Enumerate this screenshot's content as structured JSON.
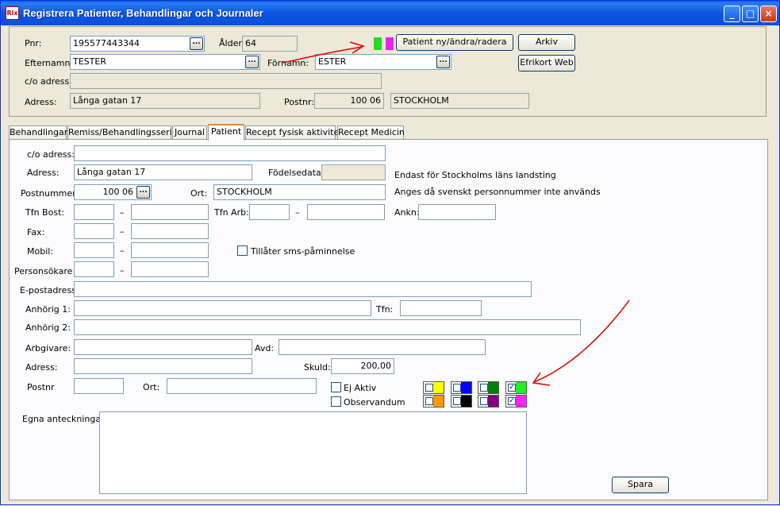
{
  "window": {
    "icon_text": "Rix",
    "title": "Registrera Patienter, Behandlingar och Journaler",
    "minimize": "_",
    "maximize": "□",
    "close": "×"
  },
  "header": {
    "pnr_label": "Pnr:",
    "pnr_value": "195577443344",
    "alder_label": "Ålder:",
    "alder_value": "64",
    "efternamn_label": "Efternamn:",
    "efternamn_value": "TESTER",
    "fornamn_label": "Förnamn:",
    "fornamn_value": "ESTER",
    "co_label": "c/o adress:",
    "co_value": "",
    "adress_label": "Adress:",
    "adress_value": "Långa gatan 17",
    "postnr_label": "Postnr:",
    "postnr_value": "100 06",
    "ort_value": "STOCKHOLM",
    "ellipsis": "...",
    "patient_button": "Patient ny/ändra/radera",
    "arkiv_button": "Arkiv",
    "efrikort_button": "Efrikort Web",
    "status_colors": [
      "#22dd22",
      "#ee22ee"
    ]
  },
  "tabs": [
    {
      "label": "Behandlingar"
    },
    {
      "label": "Remiss/Behandlingsserie"
    },
    {
      "label": "Journal"
    },
    {
      "label": "Patient"
    },
    {
      "label": "Recept fysisk aktivitet"
    },
    {
      "label": "Recept Medicin"
    }
  ],
  "patient": {
    "co_label": "c/o adress:",
    "co_value": "",
    "adress_label": "Adress:",
    "adress_value": "Långa gatan 17",
    "fodelsedata_label": "Födelsedata:",
    "fodelsedata_value": "",
    "note_stockholm": "Endast för Stockholms läns landsting",
    "postnummer_label": "Postnummer:",
    "postnummer_value": "100 06",
    "ort_label": "Ort:",
    "ort_value": "STOCKHOLM",
    "note_personnummer": "Anges då svenskt personnummer inte används",
    "tfn_bost_label": "Tfn Bost:",
    "tfn_arb_label": "Tfn Arb:",
    "ankn_label": "Ankn:",
    "fax_label": "Fax:",
    "mobil_label": "Mobil:",
    "sms_label": "Tillåter sms-påminnelse",
    "personsokare_label": "Personsökare",
    "dash": "–",
    "epost_label": "E-postadress:",
    "anhorig1_label": "Anhörig 1:",
    "tfn_label": "Tfn:",
    "anhorig2_label": "Anhörig 2:",
    "arbgivare_label": "Arbgivare:",
    "avd_label": "Avd:",
    "adress2_label": "Adress:",
    "skuld_label": "Skuld:",
    "skuld_value": "200,00",
    "postnr2_label": "Postnr",
    "ort2_label": "Ort:",
    "ej_aktiv_label": "Ej Aktiv",
    "observandum_label": "Observandum",
    "egna_label": "Egna anteckningar:",
    "spara_button": "Spara",
    "check_mark": "✓",
    "swatches": [
      {
        "color": "#ffff00",
        "checked": false
      },
      {
        "color": "#0000ff",
        "checked": false
      },
      {
        "color": "#008000",
        "checked": false
      },
      {
        "color": "#22ee22",
        "checked": true
      },
      {
        "color": "#ff9900",
        "checked": false
      },
      {
        "color": "#000000",
        "checked": false
      },
      {
        "color": "#800080",
        "checked": false
      },
      {
        "color": "#ff22ff",
        "checked": true
      }
    ]
  },
  "annotation_color": "#e00000"
}
